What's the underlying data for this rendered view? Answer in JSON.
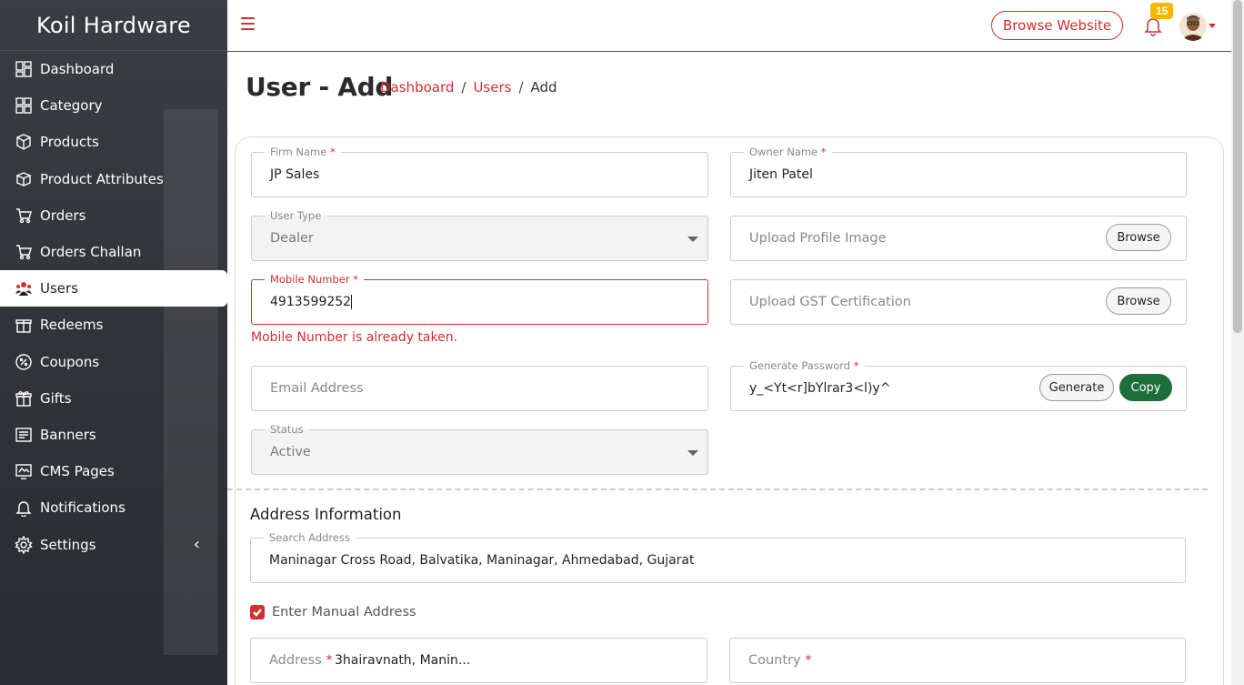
{
  "app": {
    "brand": "Koil Hardware"
  },
  "sidebar": {
    "items": [
      {
        "label": "Dashboard",
        "icon": "dashboard-icon"
      },
      {
        "label": "Category",
        "icon": "category-icon"
      },
      {
        "label": "Products",
        "icon": "products-icon"
      },
      {
        "label": "Product Attributes",
        "icon": "attributes-icon"
      },
      {
        "label": "Orders",
        "icon": "orders-icon"
      },
      {
        "label": "Orders Challan",
        "icon": "cart-icon"
      },
      {
        "label": "Users",
        "icon": "users-icon",
        "active": true
      },
      {
        "label": "Redeems",
        "icon": "gift-box-icon"
      },
      {
        "label": "Coupons",
        "icon": "coupon-icon"
      },
      {
        "label": "Gifts",
        "icon": "gift-icon"
      },
      {
        "label": "Banners",
        "icon": "banner-icon"
      },
      {
        "label": "CMS Pages",
        "icon": "cms-icon"
      },
      {
        "label": "Notifications",
        "icon": "bell-icon"
      },
      {
        "label": "Settings",
        "icon": "gear-icon"
      }
    ],
    "collapse_icon": "‹"
  },
  "topbar": {
    "browse_label": "Browse Website",
    "notification_count": "15"
  },
  "page": {
    "title": "User - Add",
    "breadcrumb": {
      "home": "Dashboard",
      "section": "Users",
      "current": "Add",
      "separator": "/"
    }
  },
  "form": {
    "firm_name": {
      "label": "Firm Name",
      "value": "JP Sales"
    },
    "owner_name": {
      "label": "Owner Name",
      "value": "Jiten Patel"
    },
    "user_type": {
      "label": "User Type",
      "value": "Dealer"
    },
    "profile_image": {
      "placeholder": "Upload Profile Image",
      "button": "Browse"
    },
    "mobile": {
      "label": "Mobile Number",
      "value": "4913599252",
      "error": "Mobile Number is already taken."
    },
    "gst": {
      "placeholder": "Upload GST Certification",
      "button": "Browse"
    },
    "email": {
      "placeholder": "Email Address"
    },
    "password": {
      "label": "Generate Password",
      "value": "y_<Yt<r]bYlrar3<l)y^",
      "generate": "Generate",
      "copy": "Copy"
    },
    "status": {
      "label": "Status",
      "value": "Active"
    },
    "required_mark": "*"
  },
  "address": {
    "section_title": "Address Information",
    "search": {
      "label": "Search Address",
      "value": "Maninagar Cross Road, Balvatika, Maninagar, Ahmedabad, Gujarat"
    },
    "manual_label": "Enter Manual Address",
    "manual_checked": true,
    "address_field": {
      "placeholder": "Address",
      "value": "3hairavnath, Manin..."
    },
    "country_field": {
      "placeholder": "Country"
    }
  },
  "colors": {
    "accent": "#d32f2f",
    "sidebar": "#2f3237",
    "copy_button": "#1e6e3a",
    "badge": "#f5b700"
  }
}
